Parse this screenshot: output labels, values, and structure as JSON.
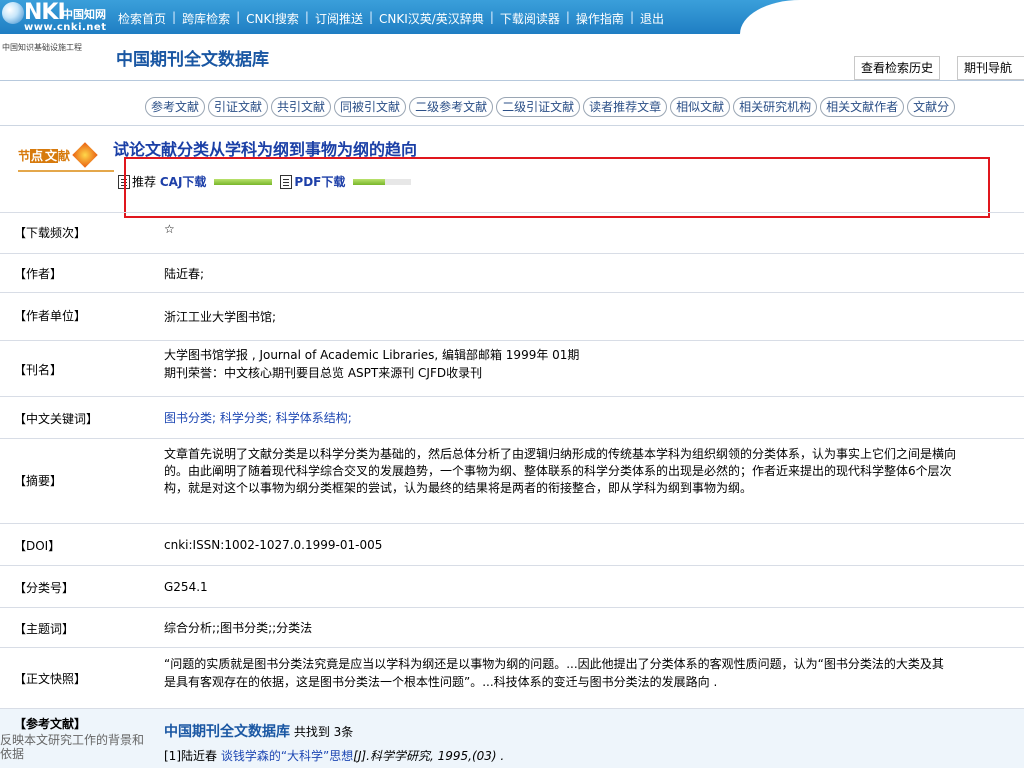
{
  "header": {
    "logo_text": "NKI",
    "logo_cn": "中国知网",
    "logo_url": "www.cnki.net",
    "nav": [
      "检索首页",
      "跨库检索",
      "CNKI搜索",
      "订阅推送",
      "CNKI汉英/英汉辞典",
      "下载阅读器",
      "操作指南",
      "退出"
    ],
    "infra_text": "中国知识基础设施工程",
    "db_title": "中国期刊全文数据库",
    "history_tab": "查看检索历史",
    "journal_nav_tab": "期刊导航"
  },
  "pills": [
    "参考文献",
    "引证文献",
    "共引文献",
    "同被引文献",
    "二级参考文献",
    "二级引证文献",
    "读者推荐文章",
    "相似文献",
    "相关研究机构",
    "相关文献作者",
    "文献分"
  ],
  "article": {
    "badge_pre": "节",
    "badge_mid": "点",
    "badge_mid2": "文",
    "badge_post": "献",
    "title": "试论文献分类从学科为纲到事物为纲的趋向",
    "recommend": "推荐",
    "caj_label": "CAJ下载",
    "caj_fill": 1.0,
    "pdf_label": "PDF下载",
    "pdf_fill": 0.55
  },
  "rows": {
    "download_freq": {
      "label": "【下载频次】",
      "value": "☆"
    },
    "author": {
      "label": "【作者】",
      "value": "陆近春;"
    },
    "affiliation": {
      "label": "【作者单位】",
      "value": "浙江工业大学图书馆;"
    },
    "journal": {
      "label": "【刊名】",
      "value1": "大学图书馆学报 , Journal of Academic Libraries, 编辑部邮箱  1999年  01期",
      "value2": "期刊荣誉：中文核心期刊要目总览  ASPT来源刊  CJFD收录刊"
    },
    "keywords": {
      "label": "【中文关键词】",
      "k1": "图书分类",
      "k2": "; 科学分类; 科学体系结构;"
    },
    "abstract": {
      "label": "【摘要】",
      "line1": "文章首先说明了文献分类是以科学分类为基础的，然后总体分析了由逻辑归纳形成的传统基本学科为组织纲领的分类体系，认为事实上它们之间是横向",
      "line2": "的。由此阐明了随着现代科学综合交叉的发展趋势，一个事物为纲、整体联系的科学分类体系的出现是必然的；作者近来提出的现代科学整体6个层次",
      "line3": "构，就是对这个以事物为纲分类框架的尝试，认为最终的结果将是两者的衔接整合，即从学科为纲到事物为纲。"
    },
    "doi": {
      "label": "【DOI】",
      "value": "cnki:ISSN:1002-1027.0.1999-01-005"
    },
    "class_no": {
      "label": "【分类号】",
      "value": "G254.1"
    },
    "subject": {
      "label": "【主题词】",
      "value": "综合分析;;图书分类;;分类法"
    },
    "snapshot": {
      "label": "【正文快照】",
      "line1": "“问题的实质就是图书分类法究竟是应当以学科为纲还是以事物为纲的问题。...因此他提出了分类体系的客观性质问题，认为“图书分类法的大类及其",
      "line2": "是具有客观存在的依据，这是图书分类法一个根本性问题”。...科技体系的变迁与图书分类法的发展路向 ."
    }
  },
  "references": {
    "label": "【参考文献】",
    "sub": "反映本文研究工作的背景和依据",
    "db_name": "中国期刊全文数据库",
    "count_text": " 共找到  3条",
    "ref1_prefix": "[1]陆近春  ",
    "ref1_link": "谈钱学森的“大科学”思想",
    "ref1_suffix": "[J].科学学研究, 1995,(03) ."
  },
  "colors": {
    "accent": "#1a57a3",
    "link": "#1d47b3",
    "highlight_box": "#e0161d",
    "topbar": "#2a8fd3"
  }
}
